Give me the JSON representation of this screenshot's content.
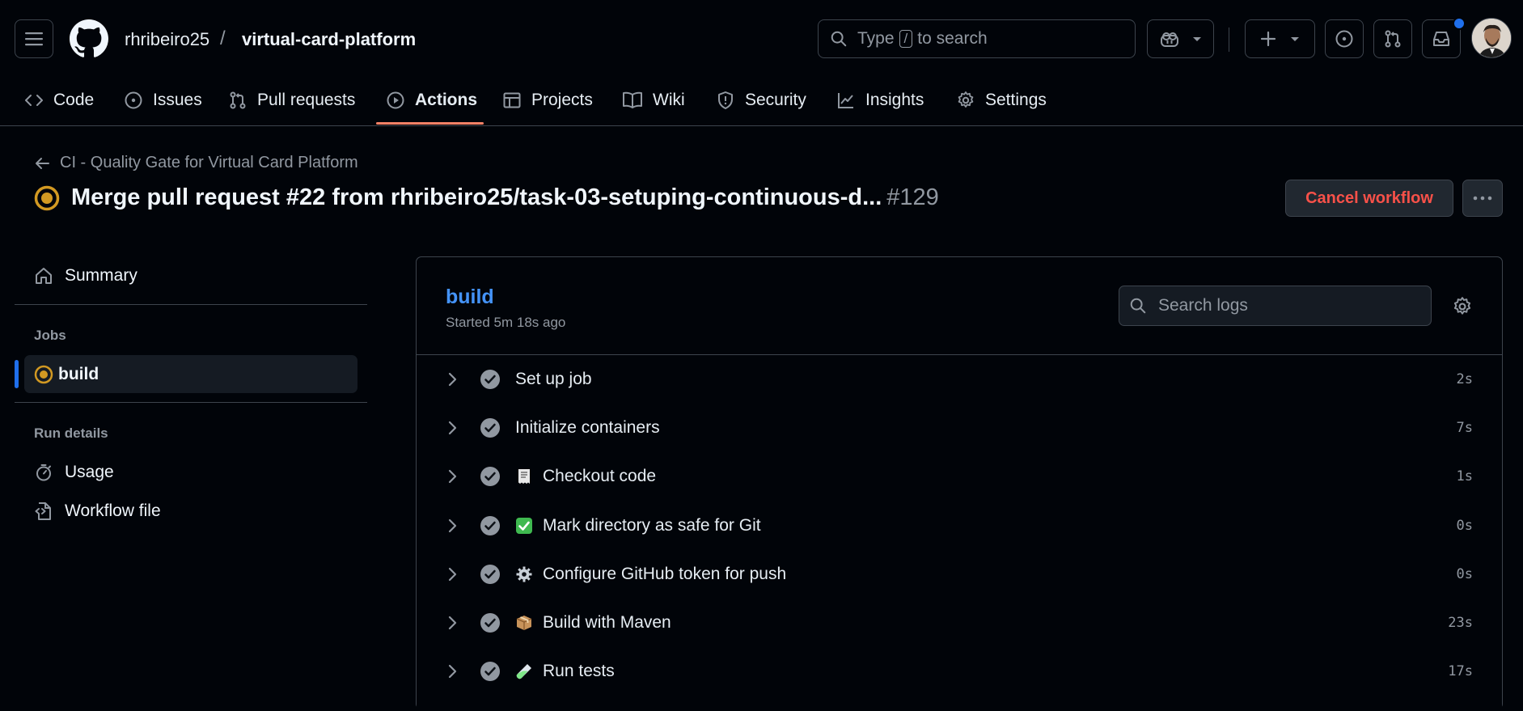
{
  "header": {
    "owner": "rhribeiro25",
    "separator": "/",
    "repo": "virtual-card-platform",
    "search_prefix": "Type",
    "search_key": "/",
    "search_suffix": "to search"
  },
  "nav": {
    "tabs": [
      {
        "label": "Code",
        "icon": "code-icon"
      },
      {
        "label": "Issues",
        "icon": "issue-opened-icon"
      },
      {
        "label": "Pull requests",
        "icon": "git-pull-request-icon"
      },
      {
        "label": "Actions",
        "icon": "play-icon",
        "active": true
      },
      {
        "label": "Projects",
        "icon": "table-icon"
      },
      {
        "label": "Wiki",
        "icon": "book-icon"
      },
      {
        "label": "Security",
        "icon": "shield-icon"
      },
      {
        "label": "Insights",
        "icon": "graph-icon"
      },
      {
        "label": "Settings",
        "icon": "gear-icon"
      }
    ]
  },
  "run": {
    "workflow_name": "CI - Quality Gate for Virtual Card Platform",
    "title": "Merge pull request #22 from rhribeiro25/task-03-setuping-continuous-d...",
    "number": "#129",
    "cancel_label": "Cancel workflow",
    "status": "in_progress"
  },
  "sidebar": {
    "summary_label": "Summary",
    "jobs_heading": "Jobs",
    "job_label": "build",
    "run_details_heading": "Run details",
    "usage_label": "Usage",
    "workflow_file_label": "Workflow file"
  },
  "job": {
    "name": "build",
    "started": "Started 5m 18s ago",
    "search_placeholder": "Search logs",
    "steps": [
      {
        "name": "Set up job",
        "duration": "2s",
        "emoji": ""
      },
      {
        "name": "Initialize containers",
        "duration": "7s",
        "emoji": ""
      },
      {
        "name": "Checkout code",
        "duration": "1s",
        "emoji": "receipt"
      },
      {
        "name": "Mark directory as safe for Git",
        "duration": "0s",
        "emoji": "check-mark-button"
      },
      {
        "name": "Configure GitHub token for push",
        "duration": "0s",
        "emoji": "gear"
      },
      {
        "name": "Build with Maven",
        "duration": "23s",
        "emoji": "package"
      },
      {
        "name": "Run tests",
        "duration": "17s",
        "emoji": "test-tube"
      }
    ]
  },
  "colors": {
    "accent_blue": "#4493f8",
    "danger": "#f85149",
    "in_progress": "#d29922",
    "active_tab_underline": "#f78166"
  }
}
